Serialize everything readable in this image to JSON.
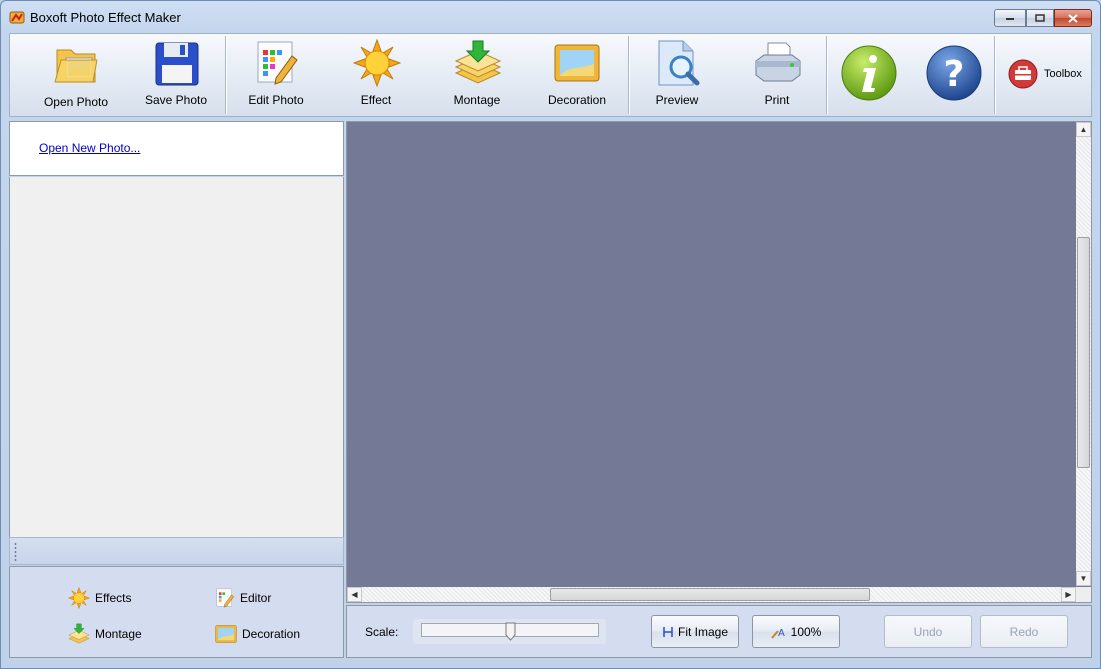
{
  "window": {
    "title": "Boxoft Photo Effect Maker"
  },
  "toolbar": {
    "open_photo": "Open Photo",
    "save_photo": "Save Photo",
    "edit_photo": "Edit Photo",
    "effect": "Effect",
    "montage": "Montage",
    "decoration": "Decoration",
    "preview": "Preview",
    "print": "Print",
    "toolbox": "Toolbox"
  },
  "left_panel": {
    "open_link": "Open New Photo...",
    "nav": {
      "effects": "Effects",
      "editor": "Editor",
      "montage": "Montage",
      "decoration": "Decoration"
    }
  },
  "bottom": {
    "scale_label": "Scale:",
    "scale_value": 0.5,
    "fit_image": "Fit Image",
    "zoom_100": "100%",
    "undo": "Undo",
    "redo": "Redo"
  },
  "colors": {
    "canvas": "#747a96",
    "link": "#0000cc",
    "info_green": "#7fb52a",
    "help_blue": "#2a57a8"
  }
}
